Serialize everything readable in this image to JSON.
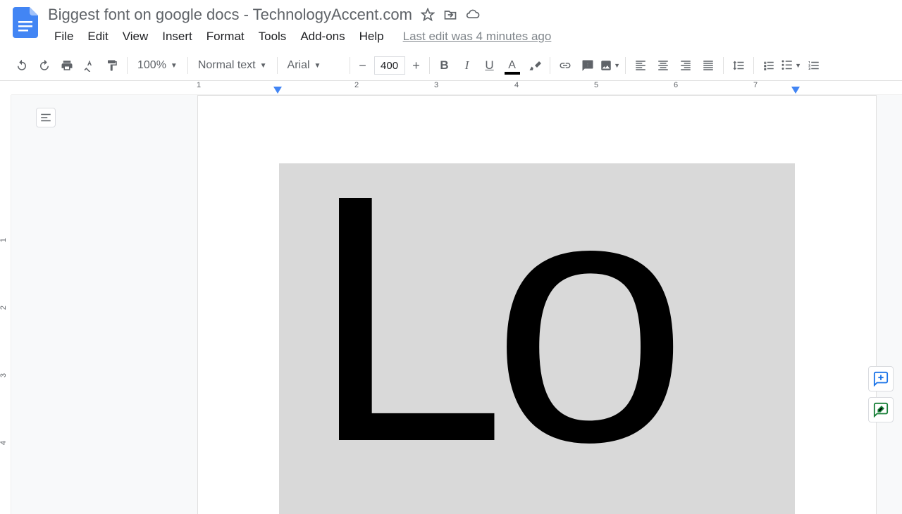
{
  "header": {
    "title": "Biggest font on google docs - TechnologyAccent.com",
    "last_edit": "Last edit was 4 minutes ago"
  },
  "menu": {
    "file": "File",
    "edit": "Edit",
    "view": "View",
    "insert": "Insert",
    "format": "Format",
    "tools": "Tools",
    "addons": "Add-ons",
    "help": "Help"
  },
  "toolbar": {
    "zoom": "100%",
    "style": "Normal text",
    "font": "Arial",
    "font_size": "400"
  },
  "ruler": {
    "marks": [
      "1",
      "2",
      "3",
      "4",
      "5",
      "6",
      "7"
    ]
  },
  "vruler": {
    "marks": [
      "1",
      "2",
      "3",
      "4"
    ]
  },
  "document": {
    "content": "Lo"
  }
}
